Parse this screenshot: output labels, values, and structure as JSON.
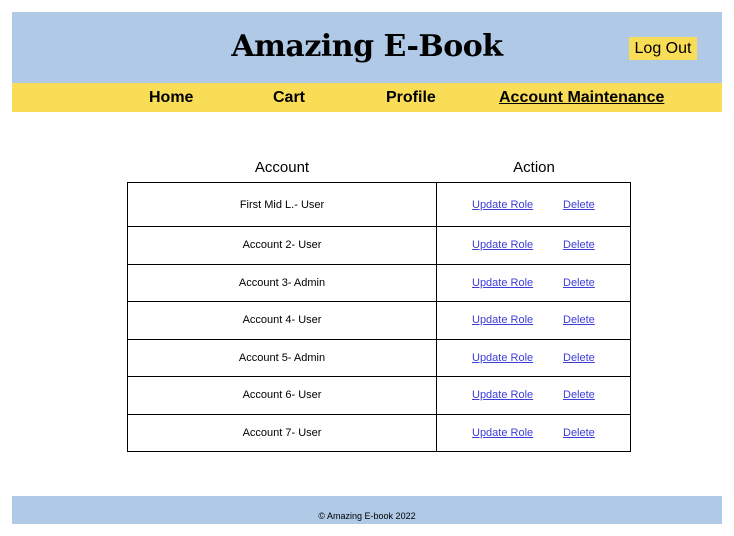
{
  "header": {
    "title": "Amazing E-Book",
    "logout_label": "Log Out"
  },
  "nav": {
    "home": "Home",
    "cart": "Cart",
    "profile": "Profile",
    "account_maintenance": "Account Maintenance"
  },
  "table": {
    "col_account": "Account",
    "col_action": "Action",
    "update_label": "Update Role",
    "delete_label": "Delete",
    "rows": [
      {
        "account": "First Mid L.- User"
      },
      {
        "account": "Account 2- User"
      },
      {
        "account": "Account 3- Admin"
      },
      {
        "account": "Account 4- User"
      },
      {
        "account": "Account 5- Admin"
      },
      {
        "account": "Account 6- User"
      },
      {
        "account": "Account 7- User"
      }
    ]
  },
  "footer": {
    "text": "© Amazing E-book 2022"
  },
  "colors": {
    "header_bg": "#afc9e6",
    "accent_yellow": "#f9dd56",
    "link": "#3d3dd8"
  }
}
